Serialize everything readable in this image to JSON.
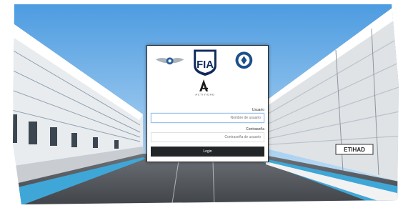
{
  "logos": {
    "fia_text": "FIA",
    "brand_text": "ACTIVIDAD"
  },
  "form": {
    "username_label": "Usuario",
    "username_placeholder": "Nombre de usuario",
    "password_label": "Contraseña",
    "password_placeholder": "Contraseña de usuario",
    "login_button": "Login"
  },
  "background": {
    "sign_text": "ETIHAD"
  },
  "colors": {
    "button": "#222629",
    "focus_border": "#9cc2ea",
    "track_curb": "#3fa7d8"
  }
}
